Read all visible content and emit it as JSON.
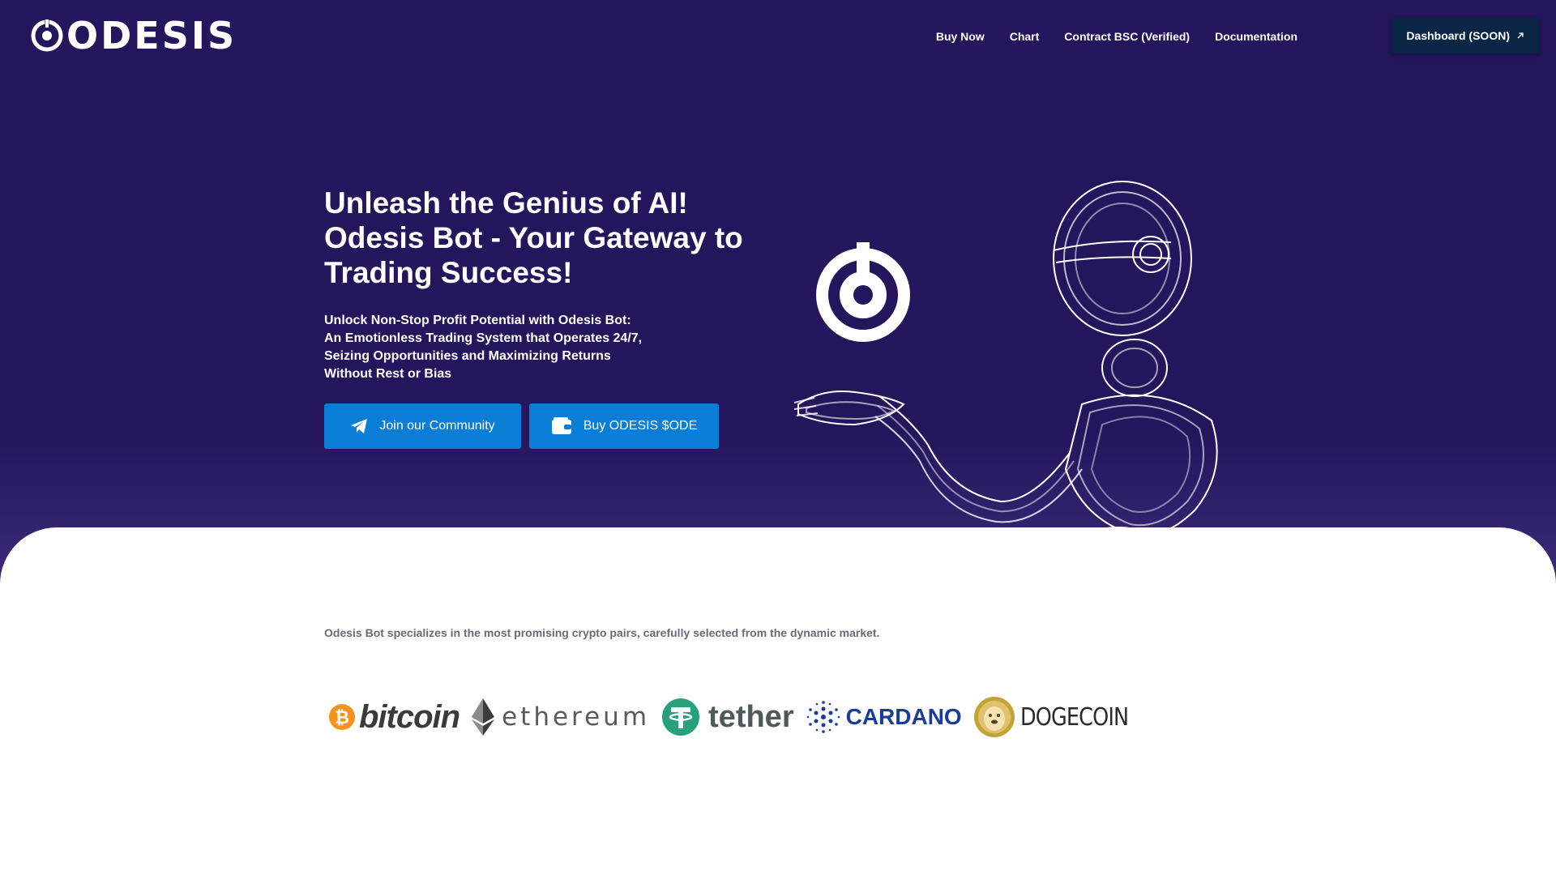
{
  "brand": {
    "name": "ODESIS"
  },
  "nav": {
    "items": [
      "Buy Now",
      "Chart",
      "Contract BSC (Verified)",
      "Documentation"
    ],
    "dashboard_label": "Dashboard (SOON)"
  },
  "hero": {
    "title": "Unleash the Genius of AI! Odesis Bot - Your Gateway to Trading Success!",
    "subtitle": "Unlock Non-Stop Profit Potential with Odesis Bot: An Emotionless Trading System that Operates 24/7, Seizing Opportunities and Maximizing Returns Without Rest or Bias",
    "community_button": "Join our Community",
    "buy_button": "Buy ODESIS $ODE"
  },
  "pairs": {
    "tagline": "Odesis Bot specializes in the most promising crypto pairs, carefully selected from the dynamic market.",
    "coins": [
      "bitcoin",
      "ethereum",
      "tether",
      "CARDANO",
      "DOGECOIN"
    ]
  },
  "colors": {
    "hero_bg": "#25155c",
    "button_blue": "#0a7ed6",
    "dashboard_bg": "#0b2545",
    "bitcoin_orange": "#f7931a",
    "tether_green": "#26a17b",
    "cardano_blue": "#1b3a9c",
    "doge_gold": "#c2a633"
  },
  "icons": [
    "telegram-icon",
    "wallet-icon",
    "external-link-icon",
    "odesis-logo-icon",
    "robot-illustration"
  ]
}
